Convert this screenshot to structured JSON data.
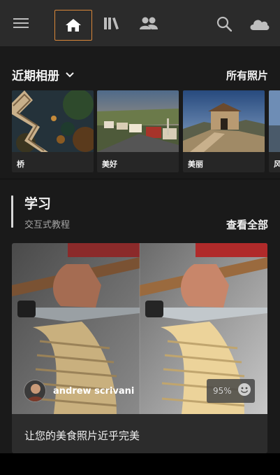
{
  "topbar": {
    "icons": [
      "menu-icon",
      "home-icon",
      "library-icon",
      "people-icon",
      "search-icon",
      "cloud-icon"
    ],
    "active": "home-icon",
    "accent": "#d9873a"
  },
  "albums": {
    "title": "近期相册",
    "all_photos": "所有照片",
    "items": [
      {
        "label": "桥"
      },
      {
        "label": "美好"
      },
      {
        "label": "美丽"
      },
      {
        "label": "风"
      }
    ]
  },
  "learn": {
    "title": "学习",
    "subtitle": "交互式教程",
    "view_all": "查看全部",
    "tutorial": {
      "author": "andrew scrivani",
      "percent": "95%",
      "caption": "让您的美食照片近乎完美"
    }
  }
}
